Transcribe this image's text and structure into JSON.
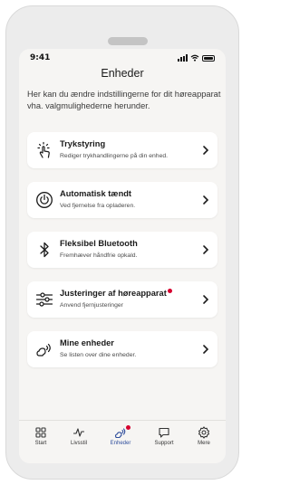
{
  "status": {
    "time": "9:41"
  },
  "header": {
    "title": "Enheder"
  },
  "intro": "Her kan du ændre indstillingerne for dit høreapparat vha. valgmulighederne herunder.",
  "menu": [
    {
      "title": "Trykstyring",
      "subtitle": "Rediger trykhandlingerne på din enhed.",
      "icon": "tap-icon",
      "badge": false
    },
    {
      "title": "Automatisk tændt",
      "subtitle": "Ved fjernelse fra opladeren.",
      "icon": "power-icon",
      "badge": false
    },
    {
      "title": "Fleksibel Bluetooth",
      "subtitle": "Fremhæver håndfrie opkald.",
      "icon": "bluetooth-icon",
      "badge": false
    },
    {
      "title": "Justeringer af høreapparat",
      "subtitle": "Anvend fjernjusteringer",
      "icon": "sliders-icon",
      "badge": true
    },
    {
      "title": "Mine enheder",
      "subtitle": "Se listen over dine enheder.",
      "icon": "hearing-aid-icon",
      "badge": false
    }
  ],
  "nav": [
    {
      "label": "Start",
      "icon": "grid-icon",
      "active": false
    },
    {
      "label": "Livsstil",
      "icon": "activity-icon",
      "active": false
    },
    {
      "label": "Enheder",
      "icon": "hearing-aid-icon",
      "active": true,
      "badge": true
    },
    {
      "label": "Support",
      "icon": "chat-icon",
      "active": false
    },
    {
      "label": "Mere",
      "icon": "settings-icon",
      "active": false
    }
  ],
  "colors": {
    "accent": "#2f4e9c",
    "badge": "#d6002e",
    "background": "#f6f5f3"
  }
}
